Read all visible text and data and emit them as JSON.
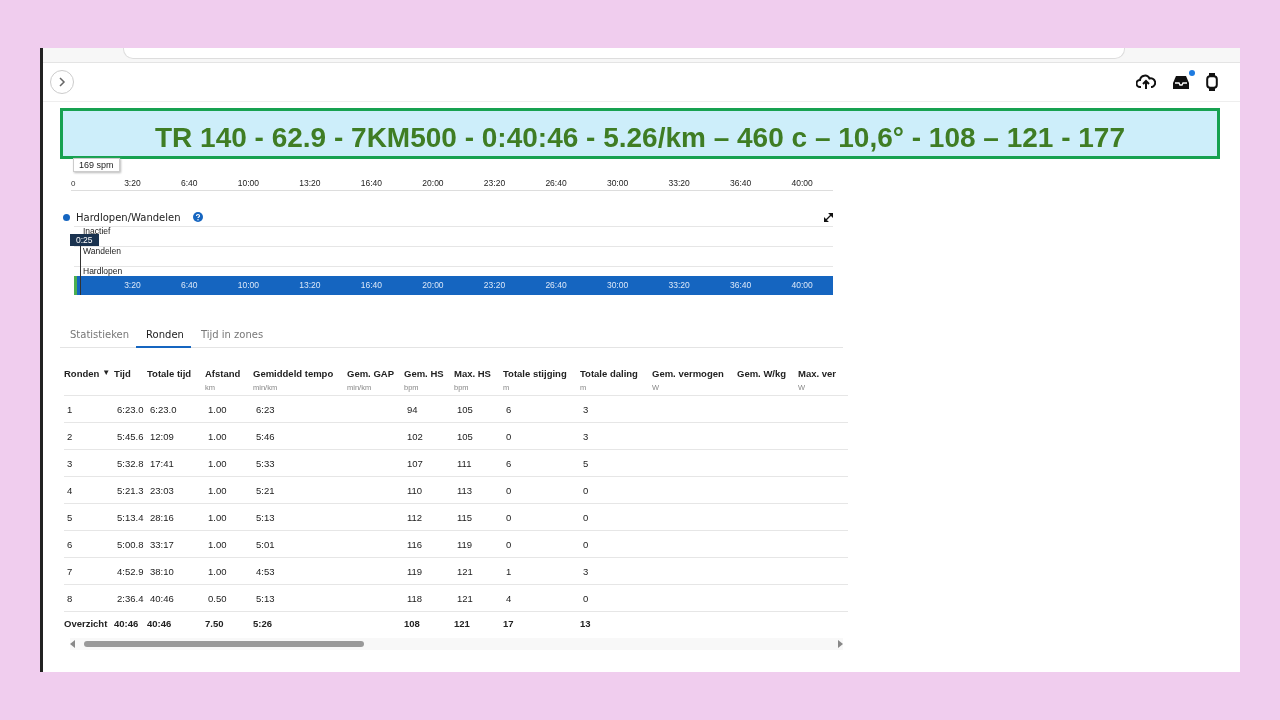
{
  "header": {
    "notification_dot": true
  },
  "banner": {
    "text": "TR 140 - 62.9 - 7KM500 - 0:40:46 - 5.26/km – 460 c – 10,6° - 108 – 121 - 177"
  },
  "cadence_chart": {
    "tooltip": "169 spm",
    "y_label": "0",
    "x_labels": [
      "3:20",
      "6:40",
      "10:00",
      "13:20",
      "16:40",
      "20:00",
      "23:20",
      "26:40",
      "30:00",
      "33:20",
      "36:40",
      "40:00"
    ]
  },
  "activity_chart": {
    "legend": "Hardlopen/Wandelen",
    "tooltip": "0:25",
    "y_labels": [
      "Inactief",
      "Wandelen",
      "Hardlopen"
    ],
    "x_labels": [
      "3:20",
      "6:40",
      "10:00",
      "13:20",
      "16:40",
      "20:00",
      "23:20",
      "26:40",
      "30:00",
      "33:20",
      "36:40",
      "40:00"
    ],
    "level": 1
  },
  "tabs": [
    {
      "label": "Statistieken",
      "selected": false
    },
    {
      "label": "Ronden",
      "selected": true
    },
    {
      "label": "Tijd in zones",
      "selected": false
    }
  ],
  "table": {
    "columns": [
      {
        "name": "Ronden",
        "sort": "▼"
      },
      {
        "name": "Tijd"
      },
      {
        "name": "Totale tijd"
      },
      {
        "name": "Afstand",
        "unit": "km"
      },
      {
        "name": "Gemiddeld tempo",
        "unit": "min/km"
      },
      {
        "name": "Gem. GAP",
        "unit": "min/km"
      },
      {
        "name": "Gem. HS",
        "unit": "bpm"
      },
      {
        "name": "Max. HS",
        "unit": "bpm"
      },
      {
        "name": "Totale stijging",
        "unit": "m"
      },
      {
        "name": "Totale daling",
        "unit": "m"
      },
      {
        "name": "Gem. vermogen",
        "unit": "W"
      },
      {
        "name": "Gem. W/kg"
      },
      {
        "name": "Max. ver",
        "unit": "W"
      }
    ],
    "rows": [
      [
        "1",
        "6:23.0",
        "6:23.0",
        "1.00",
        "6:23",
        null,
        "94",
        "105",
        "6",
        "3",
        null,
        null,
        null
      ],
      [
        "2",
        "5:45.6",
        "12:09",
        "1.00",
        "5:46",
        null,
        "102",
        "105",
        "0",
        "3",
        null,
        null,
        null
      ],
      [
        "3",
        "5:32.8",
        "17:41",
        "1.00",
        "5:33",
        null,
        "107",
        "111",
        "6",
        "5",
        null,
        null,
        null
      ],
      [
        "4",
        "5:21.3",
        "23:03",
        "1.00",
        "5:21",
        null,
        "110",
        "113",
        "0",
        "0",
        null,
        null,
        null
      ],
      [
        "5",
        "5:13.4",
        "28:16",
        "1.00",
        "5:13",
        null,
        "112",
        "115",
        "0",
        "0",
        null,
        null,
        null
      ],
      [
        "6",
        "5:00.8",
        "33:17",
        "1.00",
        "5:01",
        null,
        "116",
        "119",
        "0",
        "0",
        null,
        null,
        null
      ],
      [
        "7",
        "4:52.9",
        "38:10",
        "1.00",
        "4:53",
        null,
        "119",
        "121",
        "1",
        "3",
        null,
        null,
        null
      ],
      [
        "8",
        "2:36.4",
        "40:46",
        "0.50",
        "5:13",
        null,
        "118",
        "121",
        "4",
        "0",
        null,
        null,
        null
      ]
    ],
    "summary_rows": [
      [
        "Overzicht",
        "40:46",
        "40:46",
        "7.50",
        "5:26",
        null,
        "108",
        "121",
        "17",
        "13",
        null,
        null,
        null
      ]
    ]
  }
}
